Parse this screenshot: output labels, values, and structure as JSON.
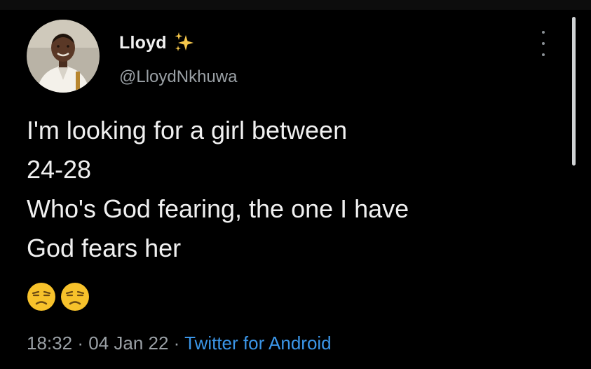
{
  "author": {
    "display_name": "Lloyd",
    "handle": "@LloydNkhuwa",
    "badge_icon": "sparkles-icon",
    "avatar_icon": "profile-photo-avatar"
  },
  "tweet": {
    "lines": [
      "I'm looking for a girl between",
      "24-28",
      "Who's God fearing, the one I have",
      "God fears her"
    ],
    "emojis": [
      "unamused-face-icon",
      "unamused-face-icon"
    ]
  },
  "meta": {
    "time": "18:32",
    "separator": "·",
    "date": "04 Jan 22",
    "source": "Twitter for Android"
  },
  "colors": {
    "background": "#000000",
    "text": "#f0f0f0",
    "secondary_text": "#9aa0a5",
    "link": "#3b96e8",
    "emoji_yellow": "#f7c22b"
  }
}
